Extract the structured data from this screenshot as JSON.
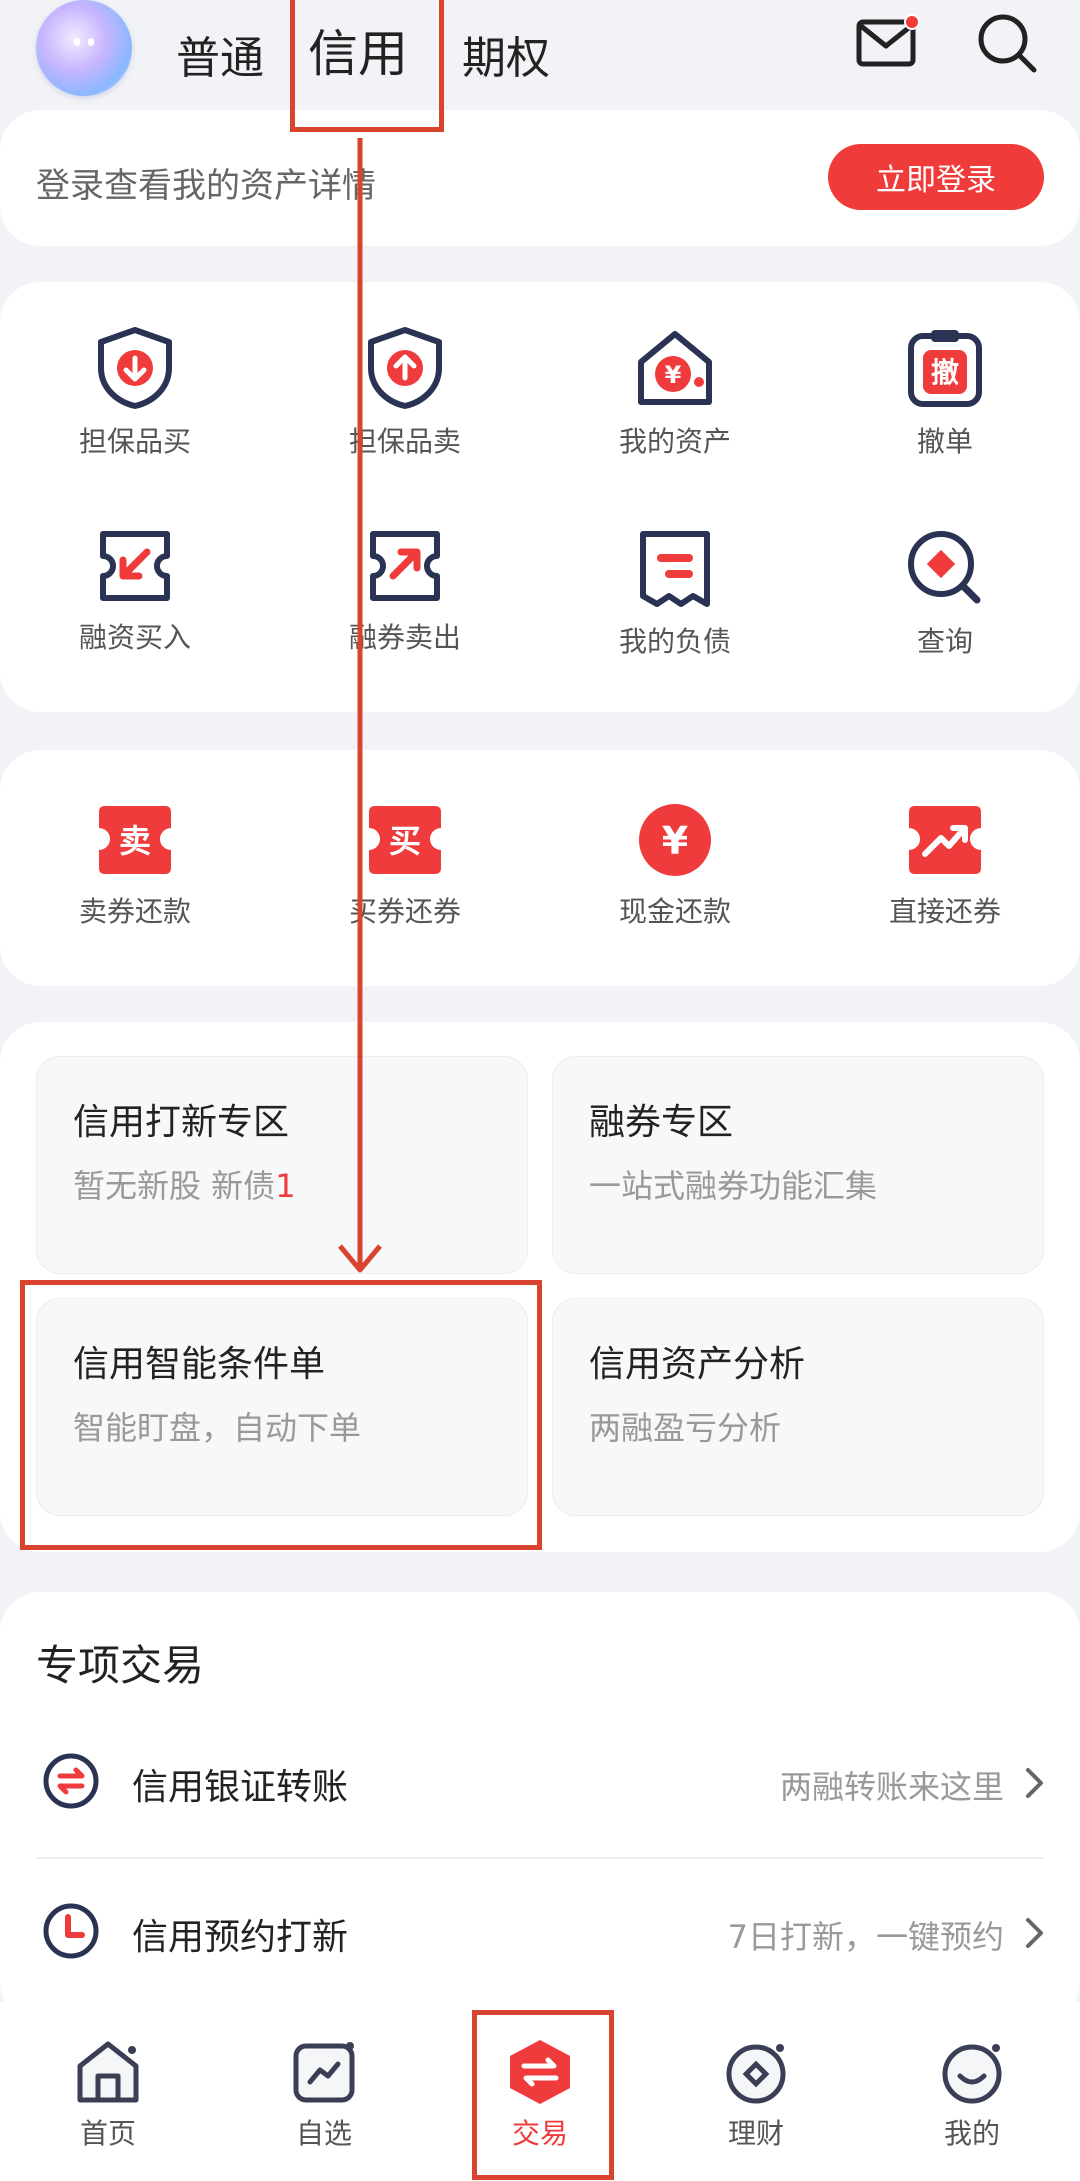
{
  "header": {
    "tabs": [
      {
        "label": "普通"
      },
      {
        "label": "信用"
      },
      {
        "label": "期权"
      }
    ]
  },
  "login": {
    "prompt": "登录查看我的资产详情",
    "button": "立即登录"
  },
  "quick_actions": [
    {
      "label": "担保品买",
      "icon": "shield-down-icon"
    },
    {
      "label": "担保品卖",
      "icon": "shield-up-icon"
    },
    {
      "label": "我的资产",
      "icon": "house-yuan-icon"
    },
    {
      "label": "撤单",
      "icon": "cancel-order-icon",
      "glyph": "撤"
    },
    {
      "label": "融资买入",
      "icon": "ticket-in-icon"
    },
    {
      "label": "融券卖出",
      "icon": "ticket-out-icon"
    },
    {
      "label": "我的负债",
      "icon": "receipt-icon"
    },
    {
      "label": "查询",
      "icon": "query-icon"
    }
  ],
  "repay_actions": [
    {
      "label": "卖券还款",
      "icon": "sell-repay-icon",
      "glyph": "卖"
    },
    {
      "label": "买券还券",
      "icon": "buy-repay-icon",
      "glyph": "买"
    },
    {
      "label": "现金还款",
      "icon": "cash-repay-icon",
      "glyph": "¥"
    },
    {
      "label": "直接还券",
      "icon": "direct-repay-icon"
    }
  ],
  "tiles": [
    {
      "title": "信用打新专区",
      "sub": "暂无新股 新债",
      "sub_badge": "1"
    },
    {
      "title": "融券专区",
      "sub": "一站式融券功能汇集"
    },
    {
      "title": "信用智能条件单",
      "sub": "智能盯盘，自动下单"
    },
    {
      "title": "信用资产分析",
      "sub": "两融盈亏分析"
    }
  ],
  "special": {
    "title": "专项交易",
    "rows": [
      {
        "title": "信用银证转账",
        "hint": "两融转账来这里",
        "icon": "transfer-icon"
      },
      {
        "title": "信用预约打新",
        "hint": "7日打新，一键预约",
        "icon": "clock-icon"
      }
    ]
  },
  "bottom_nav": [
    {
      "label": "首页",
      "icon": "home-icon"
    },
    {
      "label": "自选",
      "icon": "watchlist-icon"
    },
    {
      "label": "交易",
      "icon": "trade-icon"
    },
    {
      "label": "理财",
      "icon": "wealth-icon"
    },
    {
      "label": "我的",
      "icon": "profile-icon"
    }
  ],
  "colors": {
    "accent": "#ef3b3b",
    "annotation": "#d9442f",
    "navy": "#2b3354"
  }
}
